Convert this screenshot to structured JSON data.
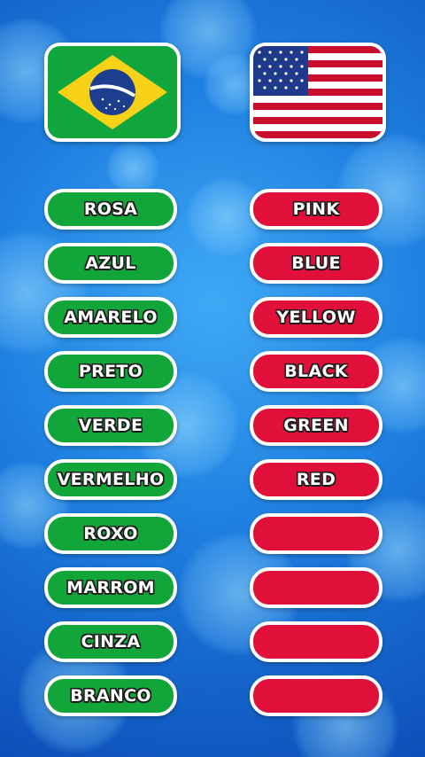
{
  "flags": {
    "left": {
      "icon": "brazil-flag-icon"
    },
    "right": {
      "icon": "usa-flag-icon"
    }
  },
  "colors": {
    "portuguese_pill": "#12a53a",
    "english_pill": "#e0103a",
    "pill_border": "#ffffff",
    "background": "#1e7fe0"
  },
  "rows": [
    {
      "pt": "ROSA",
      "en": "PINK"
    },
    {
      "pt": "AZUL",
      "en": "BLUE"
    },
    {
      "pt": "AMARELO",
      "en": "YELLOW"
    },
    {
      "pt": "PRETO",
      "en": "BLACK"
    },
    {
      "pt": "VERDE",
      "en": "GREEN"
    },
    {
      "pt": "VERMELHO",
      "en": "RED"
    },
    {
      "pt": "ROXO",
      "en": ""
    },
    {
      "pt": "MARROM",
      "en": ""
    },
    {
      "pt": "CINZA",
      "en": ""
    },
    {
      "pt": "BRANCO",
      "en": ""
    }
  ]
}
